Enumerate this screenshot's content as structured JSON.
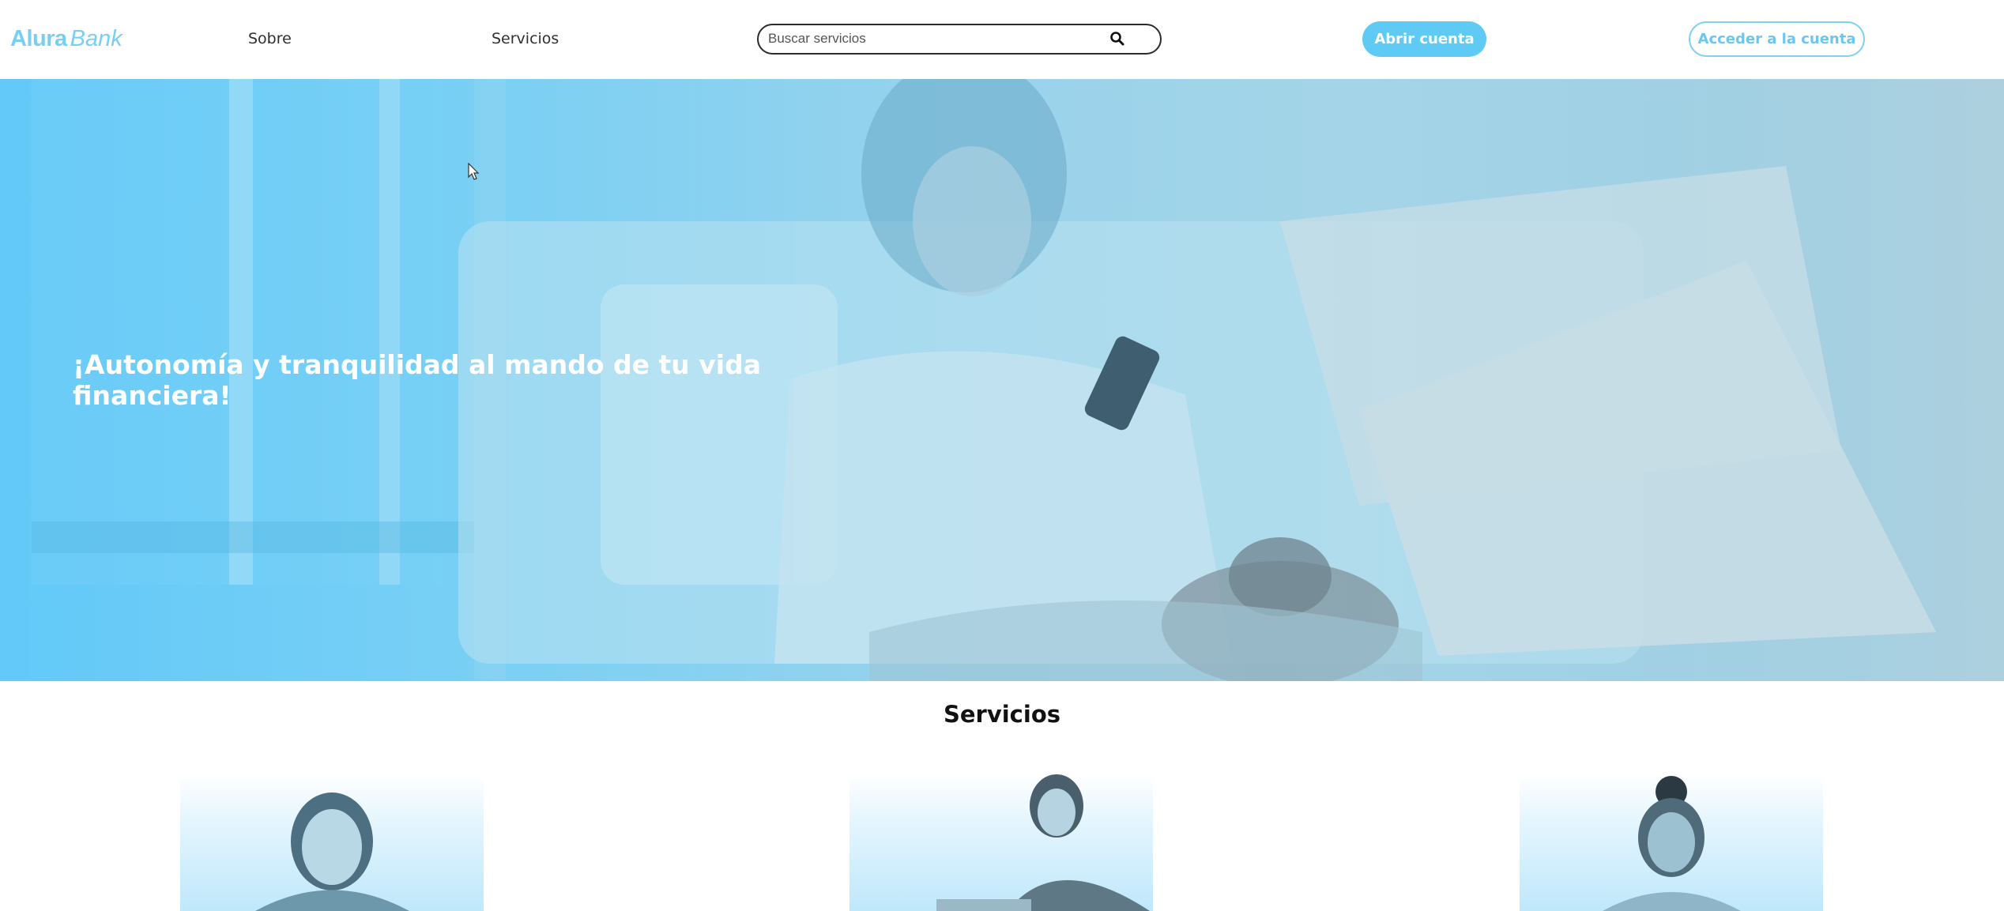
{
  "brand": {
    "name_bold": "Alura",
    "name_italic": "Bank",
    "color": "#79cfef"
  },
  "nav": {
    "links": [
      {
        "label": "Sobre"
      },
      {
        "label": "Servicios"
      }
    ],
    "search": {
      "placeholder": "Buscar servicios",
      "value": "",
      "icon": "search-icon"
    },
    "open_account_label": "Abrir cuenta",
    "access_account_label": "Acceder a la cuenta"
  },
  "hero": {
    "title": "¡Autonomía y tranquilidad al mando de tu vida financiera!",
    "overlay_color": "#62c9f8"
  },
  "services": {
    "title": "Servicios",
    "cards": [
      {
        "image": "smiling-woman-photo"
      },
      {
        "image": "man-with-card-photo"
      },
      {
        "image": "smiling-woman-photo"
      }
    ]
  },
  "colors": {
    "accent": "#5fcbf4",
    "accent_outline": "#7dd3f3",
    "text_dark": "#2f2f2f"
  }
}
